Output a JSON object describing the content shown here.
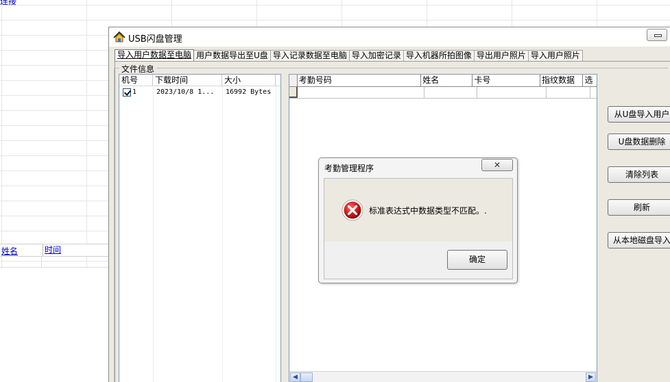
{
  "background": {
    "top_text": "连接",
    "columns": [
      "姓名",
      "时间"
    ]
  },
  "window": {
    "title": "USB闪盘管理",
    "tabs": [
      {
        "label": "导入用户数据至电脑",
        "active": true
      },
      {
        "label": "用户数据导出至U盘",
        "active": false
      },
      {
        "label": "导入记录数据至电脑",
        "active": false
      },
      {
        "label": "导入加密记录",
        "active": false
      },
      {
        "label": "导入机器所拍图像",
        "active": false
      },
      {
        "label": "导出用户照片",
        "active": false
      },
      {
        "label": "导入用户照片",
        "active": false
      }
    ],
    "group_title": "文件信息",
    "file_list": {
      "headers": [
        "机号",
        "下载时间",
        "大小"
      ],
      "rows": [
        {
          "checked": true,
          "id": "1",
          "time": "2023/10/8 1...",
          "size": "16992 Bytes"
        }
      ]
    },
    "grid": {
      "headers": [
        "考勤号码",
        "姓名",
        "卡号",
        "指纹数据",
        "选"
      ]
    },
    "buttons": [
      {
        "label": "从U盘导入用户"
      },
      {
        "label": "U盘数据删除"
      },
      {
        "label": "清除列表"
      },
      {
        "label": "刷新"
      },
      {
        "label": "从本地磁盘导入"
      }
    ]
  },
  "dialog": {
    "title": "考勤管理程序",
    "close_glyph": "✕",
    "message": "标准表达式中数据类型不匹配。.",
    "ok_label": "确定",
    "icon": "error-icon"
  },
  "colors": {
    "link_blue": "#0000cc",
    "error_red": "#c8102e",
    "window_bg": "#ebe9e0"
  }
}
